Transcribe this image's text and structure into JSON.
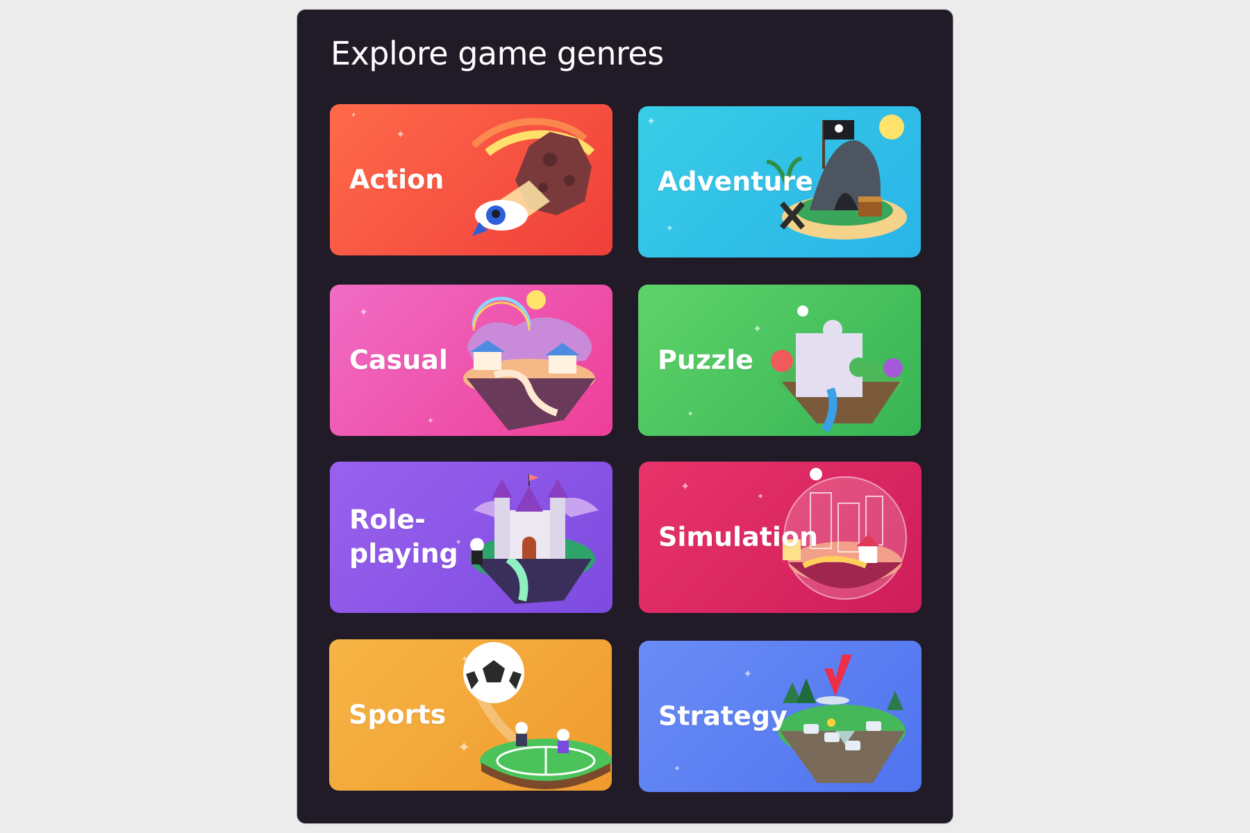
{
  "panel": {
    "title": "Explore game genres"
  },
  "genres": [
    {
      "label": "Action",
      "icon": "rocket-asteroid-icon",
      "color": "#ef4a3c"
    },
    {
      "label": "Adventure",
      "icon": "pirate-island-icon",
      "color": "#33c2e6"
    },
    {
      "label": "Casual",
      "icon": "floating-village-icon",
      "color": "#ee4fa8"
    },
    {
      "label": "Puzzle",
      "icon": "puzzle-piece-island-icon",
      "color": "#45c25c"
    },
    {
      "label": "Role-\nplaying",
      "icon": "castle-island-icon",
      "color": "#8654e6"
    },
    {
      "label": "Simulation",
      "icon": "glass-dome-city-icon",
      "color": "#d9285f"
    },
    {
      "label": "Sports",
      "icon": "soccer-field-icon",
      "color": "#f2a635"
    },
    {
      "label": "Strategy",
      "icon": "board-game-island-icon",
      "color": "#5a7ff2"
    }
  ]
}
